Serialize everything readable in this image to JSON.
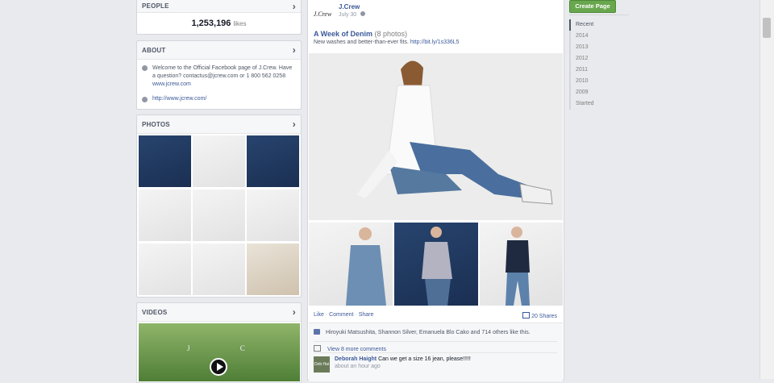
{
  "people": {
    "title": "PEOPLE",
    "likes_count": "1,253,196",
    "likes_label": "likes"
  },
  "about": {
    "title": "ABOUT",
    "welcome": "Welcome to the Official Facebook page of J.Crew. Have a question? contactus@jcrew.com or 1 800 562 0258",
    "welcome_link": "www.jcrew.com",
    "website": "http://www.jcrew.com/"
  },
  "photos": {
    "title": "PHOTOS"
  },
  "videos": {
    "title": "VIDEOS",
    "video_letters": "J C"
  },
  "post": {
    "page_name": "J.Crew",
    "date": "July 30",
    "logo_text": "J.Crew",
    "album_title": "A Week of Denim",
    "album_count": "(8 photos)",
    "description": "New washes and better-than-ever fits.",
    "description_link": "http://bit.ly/1s336L5",
    "actions": {
      "like": "Like",
      "comment": "Comment",
      "share": "Share",
      "separator": "·"
    },
    "shares": "20 Shares",
    "likers": "Hiroyuki Matsushita, Shannon Silver, Emanuela Blo Cako and 714 others like this.",
    "view_more": "View 8 more comments",
    "comment": {
      "author": "Deborah Haight",
      "text": "Can we get a size 16 jean, please!!!!!",
      "time": "about an hour ago",
      "avatar_text": "Deb Hai"
    }
  },
  "sidebar_right": {
    "create_page": "Create Page",
    "timeline": [
      "Recent",
      "2014",
      "2013",
      "2012",
      "2011",
      "2010",
      "2009",
      "Started"
    ]
  },
  "colors": {
    "brand": "#3b5998",
    "create_green": "#69a74e",
    "page_bg": "#e9eaed"
  }
}
